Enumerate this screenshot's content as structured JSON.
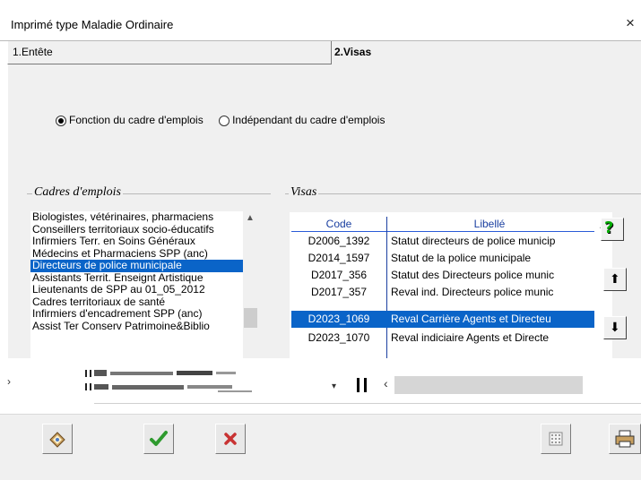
{
  "window": {
    "title": "Imprimé type Maladie Ordinaire",
    "close_glyph": "×"
  },
  "tabs": [
    {
      "label": "1.Entête",
      "active": false
    },
    {
      "label": "2.Visas",
      "active": true
    }
  ],
  "radio": {
    "option1": "Fonction du cadre d'emplois",
    "option2": "Indépendant du cadre d'emplois",
    "selected": "option1"
  },
  "cadres": {
    "label": "Cadres d'emplois",
    "items": [
      "Biologistes, vétérinaires, pharmaciens",
      "Conseillers territoriaux socio-éducatifs",
      "Infirmiers Terr. en Soins Généraux",
      "Médecins et Pharmaciens SPP (anc)",
      "Directeurs de police municipale",
      "Assistants Territ. Enseignt Artistique",
      "Lieutenants de SPP au 01_05_2012",
      "Cadres territoriaux de santé",
      "Infirmiers d'encadrement SPP (anc)",
      "Assist Ter Conserv Patrimoine&Biblio"
    ],
    "selected_index": 4
  },
  "visas": {
    "label": "Visas",
    "columns": {
      "code": "Code",
      "libelle": "Libellé"
    },
    "rows": [
      {
        "code": "D2006_1392",
        "libelle": "Statut directeurs de police municip"
      },
      {
        "code": "D2014_1597",
        "libelle": "Statut de la police municipale"
      },
      {
        "code": "D2017_356",
        "libelle": "Statut des Directeurs police munic"
      },
      {
        "code": "D2017_357",
        "libelle": "Reval ind. Directeurs police munic"
      },
      {
        "code": "D2023_1069",
        "libelle": "Reval Carrière Agents et Directeu"
      },
      {
        "code": "D2023_1070",
        "libelle": "Reval indiciaire Agents et Directe"
      }
    ],
    "selected_index": 4
  },
  "side_buttons": {
    "help": "?",
    "up": "⬆",
    "down": "⬇"
  },
  "icons": {
    "toolbar": [
      "document-edit-icon",
      "checkmark-icon",
      "cancel-x-icon",
      "calculator-icon",
      "printer-icon"
    ]
  },
  "colors": {
    "selection": "#0a64c8",
    "panel": "#f0f0f0",
    "header_text": "#1a3fa0",
    "ok_green": "#2e9a2e",
    "cancel_red": "#c83232"
  }
}
